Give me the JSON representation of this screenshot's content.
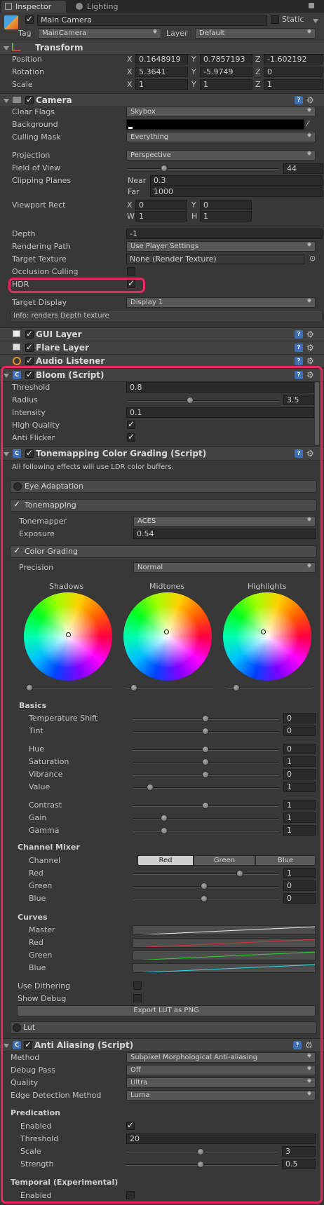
{
  "tabs": {
    "inspector": "Inspector",
    "lighting": "Lighting"
  },
  "object": {
    "name": "Main Camera",
    "static_label": "Static",
    "tag_label": "Tag",
    "tag_value": "MainCamera",
    "layer_label": "Layer",
    "layer_value": "Default"
  },
  "transform": {
    "title": "Transform",
    "position": {
      "label": "Position",
      "x": "0.1648919",
      "y": "0.7857193",
      "z": "-1.602192"
    },
    "rotation": {
      "label": "Rotation",
      "x": "5.3641",
      "y": "-5.9749",
      "z": "0"
    },
    "scale": {
      "label": "Scale",
      "x": "1",
      "y": "1",
      "z": "1"
    }
  },
  "axis": {
    "x": "X",
    "y": "Y",
    "z": "Z",
    "w": "W",
    "h": "H"
  },
  "camera": {
    "title": "Camera",
    "clear_flags": {
      "label": "Clear Flags",
      "value": "Skybox"
    },
    "background": {
      "label": "Background"
    },
    "culling_mask": {
      "label": "Culling Mask",
      "value": "Everything"
    },
    "projection": {
      "label": "Projection",
      "value": "Perspective"
    },
    "fov": {
      "label": "Field of View",
      "value": "44",
      "fraction": 0.27
    },
    "clipping": {
      "label": "Clipping Planes",
      "near_label": "Near",
      "near": "0.3",
      "far_label": "Far",
      "far": "1000"
    },
    "viewport": {
      "label": "Viewport Rect",
      "x": "0",
      "y": "0",
      "w": "1",
      "h": "1"
    },
    "depth": {
      "label": "Depth",
      "value": "-1"
    },
    "rendering_path": {
      "label": "Rendering Path",
      "value": "Use Player Settings"
    },
    "target_texture": {
      "label": "Target Texture",
      "value": "None (Render Texture)"
    },
    "occlusion": {
      "label": "Occlusion Culling",
      "checked": false
    },
    "hdr": {
      "label": "HDR",
      "checked": true
    },
    "target_display": {
      "label": "Target Display",
      "value": "Display 1"
    },
    "info": "Info: renders Depth texture"
  },
  "gui_layer": "GUI Layer",
  "flare_layer": "Flare Layer",
  "audio_listener": "Audio Listener",
  "bloom": {
    "title": "Bloom (Script)",
    "threshold": {
      "label": "Threshold",
      "value": "0.8"
    },
    "radius": {
      "label": "Radius",
      "value": "3.5",
      "fraction": 0.43
    },
    "intensity": {
      "label": "Intensity",
      "value": "0.1"
    },
    "high_quality": {
      "label": "High Quality",
      "checked": true
    },
    "anti_flicker": {
      "label": "Anti Flicker",
      "checked": true
    }
  },
  "tonemap": {
    "title": "Tonemapping Color Grading (Script)",
    "note": "All following effects will use LDR color buffers.",
    "eye_adaptation": "Eye Adaptation",
    "tonemapping": "Tonemapping",
    "tonemapper": {
      "label": "Tonemapper",
      "value": "ACES"
    },
    "exposure": {
      "label": "Exposure",
      "value": "0.54"
    },
    "color_grading": "Color Grading",
    "precision": {
      "label": "Precision",
      "value": "Normal"
    },
    "wheels": [
      "Shadows",
      "Midtones",
      "Highlights"
    ],
    "basics": "Basics",
    "temperature": {
      "label": "Temperature Shift",
      "value": "0"
    },
    "tint": {
      "label": "Tint",
      "value": "0"
    },
    "hue": {
      "label": "Hue",
      "value": "0"
    },
    "saturation": {
      "label": "Saturation",
      "value": "1"
    },
    "vibrance": {
      "label": "Vibrance",
      "value": "0"
    },
    "value": {
      "label": "Value",
      "value": "1"
    },
    "contrast": {
      "label": "Contrast",
      "value": "1"
    },
    "gain": {
      "label": "Gain",
      "value": "1"
    },
    "gamma": {
      "label": "Gamma",
      "value": "1"
    },
    "channel_mixer": "Channel Mixer",
    "channel": {
      "label": "Channel",
      "options": [
        "Red",
        "Green",
        "Blue"
      ],
      "selected": "Red"
    },
    "mix_red": {
      "label": "Red",
      "value": "1"
    },
    "mix_green": {
      "label": "Green",
      "value": "0"
    },
    "mix_blue": {
      "label": "Blue",
      "value": "0"
    },
    "curves": "Curves",
    "curve_labels": [
      "Master",
      "Red",
      "Green",
      "Blue"
    ],
    "use_dithering": "Use Dithering",
    "show_debug": "Show Debug",
    "export_button": "Export LUT as PNG",
    "lut": "Lut"
  },
  "aa": {
    "title": "Anti Aliasing (Script)",
    "method": {
      "label": "Method",
      "value": "Subpixel Morphological Anti-aliasing"
    },
    "debug_pass": {
      "label": "Debug Pass",
      "value": "Off"
    },
    "quality": {
      "label": "Quality",
      "value": "Ultra"
    },
    "edge": {
      "label": "Edge Detection Method",
      "value": "Luma"
    },
    "predication": "Predication",
    "enabled": {
      "label": "Enabled",
      "checked": true
    },
    "threshold": {
      "label": "Threshold",
      "value": "20"
    },
    "scale": {
      "label": "Scale",
      "value": "3"
    },
    "strength": {
      "label": "Strength",
      "value": "0.5"
    },
    "temporal": "Temporal (Experimental)",
    "temporal_enabled": {
      "label": "Enabled",
      "checked": false
    }
  },
  "colors": {
    "highlight": "#e8285e",
    "panel": "#383838",
    "header": "#424242"
  }
}
